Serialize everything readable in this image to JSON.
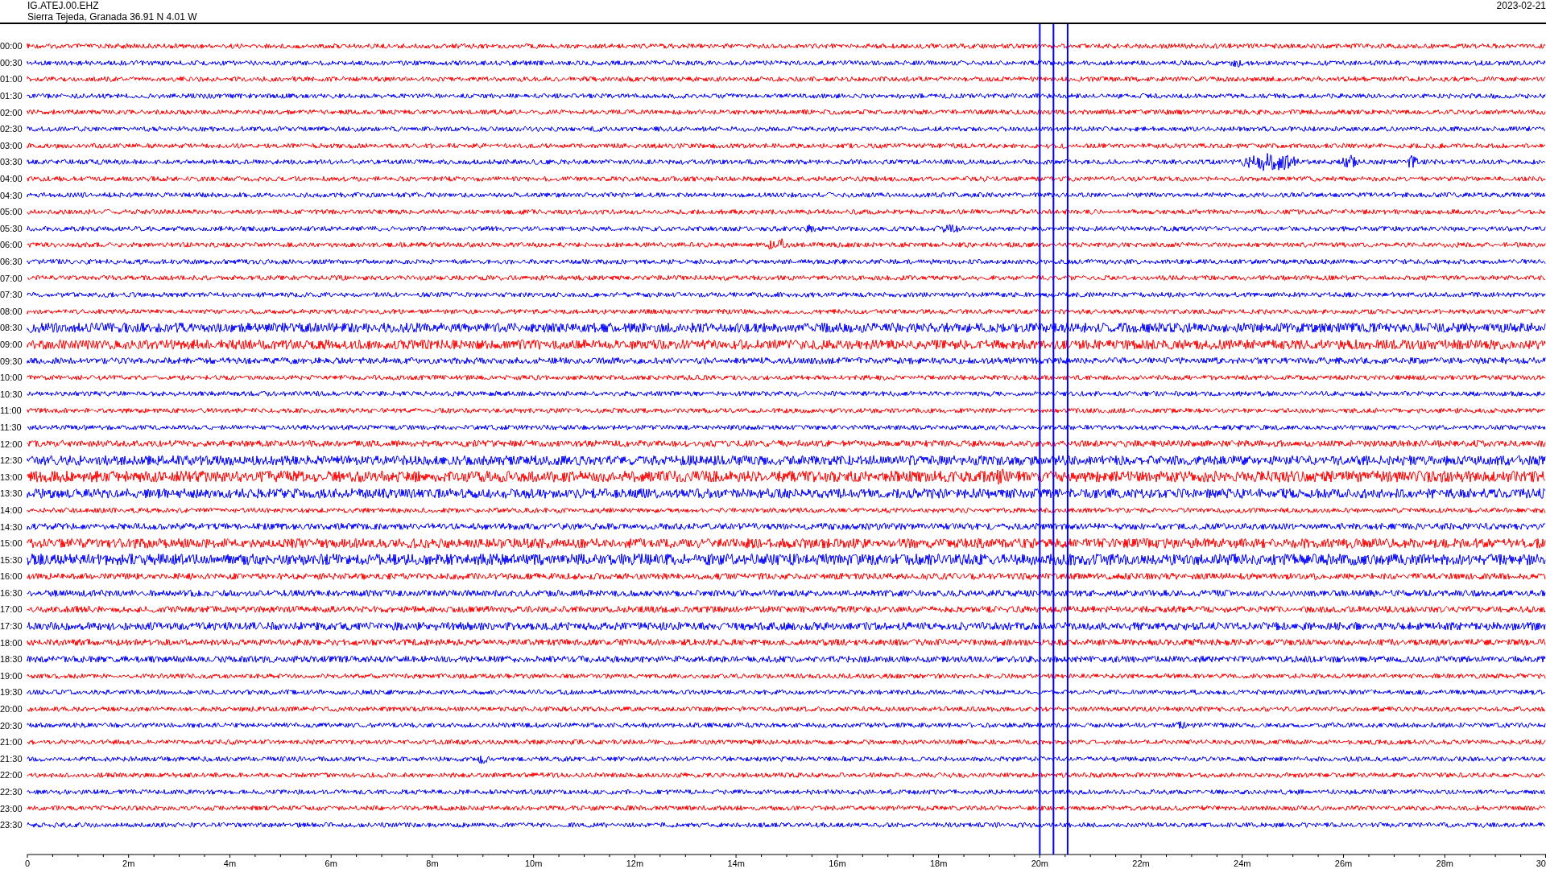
{
  "header": {
    "station": "IG.ATEJ.00.EHZ",
    "location": "Sierra Tejeda, Granada  36.91 N 4.01 W",
    "date": "2023-02-21"
  },
  "traces": [
    {
      "label": "00:00",
      "color": "#ff0000"
    },
    {
      "label": "00:30",
      "color": "#0000ff"
    },
    {
      "label": "01:00",
      "color": "#ff0000"
    },
    {
      "label": "01:30",
      "color": "#0000ff"
    },
    {
      "label": "02:00",
      "color": "#ff0000"
    },
    {
      "label": "02:30",
      "color": "#0000ff"
    },
    {
      "label": "03:00",
      "color": "#ff0000"
    },
    {
      "label": "03:30",
      "color": "#0000ff"
    },
    {
      "label": "04:00",
      "color": "#ff0000"
    },
    {
      "label": "04:30",
      "color": "#0000ff"
    },
    {
      "label": "05:00",
      "color": "#ff0000"
    },
    {
      "label": "05:30",
      "color": "#0000ff"
    },
    {
      "label": "06:00",
      "color": "#ff0000"
    },
    {
      "label": "06:30",
      "color": "#0000ff"
    },
    {
      "label": "07:00",
      "color": "#ff0000"
    },
    {
      "label": "07:30",
      "color": "#0000ff"
    },
    {
      "label": "08:00",
      "color": "#ff0000"
    },
    {
      "label": "08:30",
      "color": "#0000ff"
    },
    {
      "label": "09:00",
      "color": "#ff0000"
    },
    {
      "label": "09:30",
      "color": "#0000ff"
    },
    {
      "label": "10:00",
      "color": "#ff0000"
    },
    {
      "label": "10:30",
      "color": "#0000ff"
    },
    {
      "label": "11:00",
      "color": "#ff0000"
    },
    {
      "label": "11:30",
      "color": "#0000ff"
    },
    {
      "label": "12:00",
      "color": "#ff0000"
    },
    {
      "label": "12:30",
      "color": "#0000ff"
    },
    {
      "label": "13:00",
      "color": "#ff0000"
    },
    {
      "label": "13:30",
      "color": "#0000ff"
    },
    {
      "label": "14:00",
      "color": "#ff0000"
    },
    {
      "label": "14:30",
      "color": "#0000ff"
    },
    {
      "label": "15:00",
      "color": "#ff0000"
    },
    {
      "label": "15:30",
      "color": "#0000ff"
    },
    {
      "label": "16:00",
      "color": "#ff0000"
    },
    {
      "label": "16:30",
      "color": "#0000ff"
    },
    {
      "label": "17:00",
      "color": "#ff0000"
    },
    {
      "label": "17:30",
      "color": "#0000ff"
    },
    {
      "label": "18:00",
      "color": "#ff0000"
    },
    {
      "label": "18:30",
      "color": "#0000ff"
    },
    {
      "label": "19:00",
      "color": "#ff0000"
    },
    {
      "label": "19:30",
      "color": "#0000ff"
    },
    {
      "label": "20:00",
      "color": "#ff0000"
    },
    {
      "label": "20:30",
      "color": "#0000ff"
    },
    {
      "label": "21:00",
      "color": "#ff0000"
    },
    {
      "label": "21:30",
      "color": "#0000ff"
    },
    {
      "label": "22:00",
      "color": "#ff0000"
    },
    {
      "label": "22:30",
      "color": "#0000ff"
    },
    {
      "label": "23:00",
      "color": "#ff0000"
    },
    {
      "label": "23:30",
      "color": "#0000ff"
    }
  ],
  "x_axis": {
    "labels": [
      "0",
      "2m",
      "4m",
      "6m",
      "8m",
      "10m",
      "12m",
      "14m",
      "16m",
      "18m",
      "20m",
      "22m",
      "24m",
      "26m",
      "28m",
      "30"
    ]
  }
}
